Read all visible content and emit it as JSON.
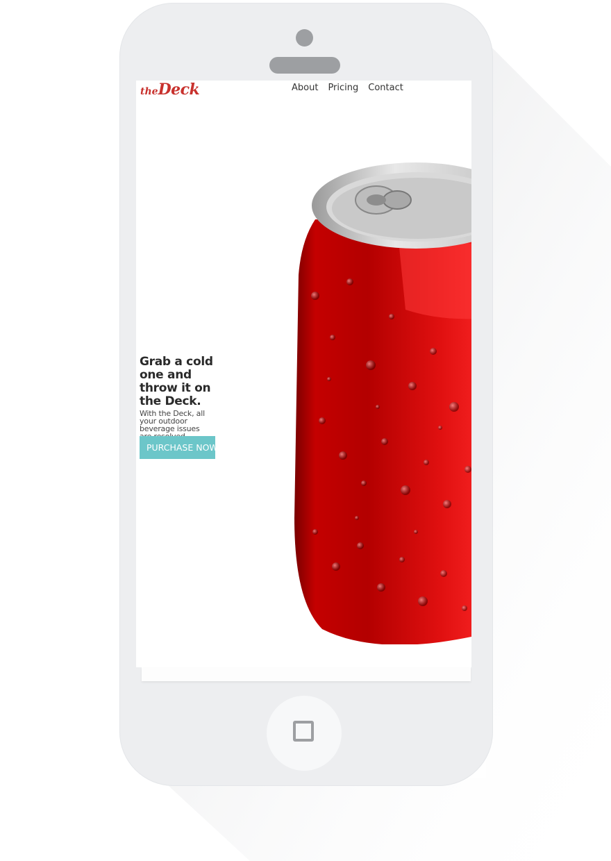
{
  "brand": {
    "logo_small": "the",
    "logo_large": "Deck"
  },
  "nav": {
    "about": "About",
    "pricing": "Pricing",
    "contact": "Contact"
  },
  "hero": {
    "headline": "Grab a cold one and throw it on the Deck.",
    "subtext": "With the Deck, all your outdoor beverage issues are resolved.",
    "cta_label": "PURCHASE NOW"
  },
  "colors": {
    "brand_red": "#c8312d",
    "cta_teal": "#6cc6c9",
    "phone_body": "#edeef0",
    "can_red": "#d40f0f"
  },
  "icons": {
    "home_button": "home-square-icon",
    "camera": "camera-dot",
    "speaker": "speaker-slot"
  }
}
